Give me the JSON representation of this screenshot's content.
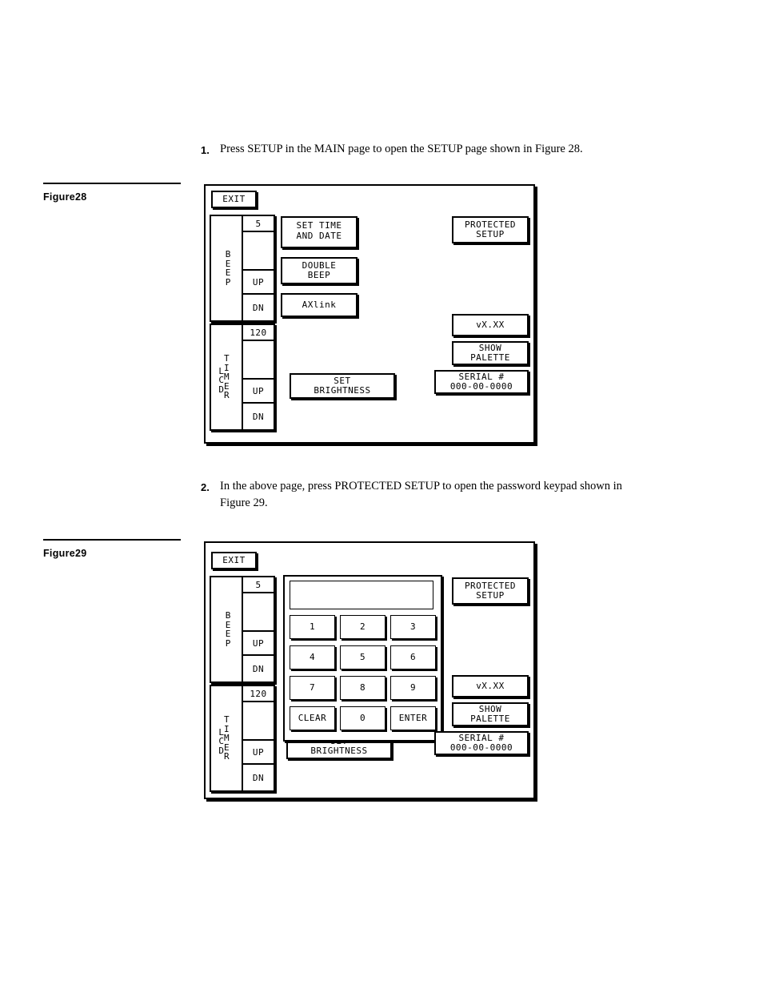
{
  "document": {
    "steps": [
      {
        "number": "1.",
        "text": "Press SETUP in the MAIN page to open the SETUP page shown in Figure 28."
      },
      {
        "number": "2.",
        "text": "In the above page, press PROTECTED SETUP to open the password keypad shown in Figure 29."
      }
    ],
    "figure_captions": [
      {
        "label": "Figure28"
      },
      {
        "label": "Figure29"
      }
    ]
  },
  "figure28": {
    "exit_button": "EXIT",
    "beep_group": {
      "label_primary": "BEEP",
      "value": "5",
      "up": "UP",
      "down": "DN"
    },
    "lcd_timer_group": {
      "label_primary": "LCD",
      "label_secondary": "TIMER",
      "value": "120",
      "up": "UP",
      "down": "DN"
    },
    "center_buttons": [
      {
        "name": "set-time-and-date",
        "line1": "SET TIME",
        "line2": "AND DATE"
      },
      {
        "name": "double-beep",
        "line1": "DOUBLE",
        "line2": "BEEP"
      },
      {
        "name": "axlink",
        "line1": "AXlink",
        "line2": ""
      },
      {
        "name": "set-brightness",
        "line1": "SET",
        "line2": "BRIGHTNESS"
      }
    ],
    "right_buttons": [
      {
        "name": "protected-setup",
        "line1": "PROTECTED",
        "line2": "SETUP"
      },
      {
        "name": "firmware-version",
        "line1": "vX.XX",
        "line2": ""
      },
      {
        "name": "show-palette",
        "line1": "SHOW",
        "line2": "PALETTE"
      },
      {
        "name": "serial-number",
        "line1": "SERIAL #",
        "line2": "000-00-0000"
      }
    ]
  },
  "figure29": {
    "exit_button": "EXIT",
    "beep_group": {
      "label_primary": "BEEP",
      "value": "5",
      "up": "UP",
      "down": "DN"
    },
    "lcd_timer_group": {
      "label_primary": "LCD",
      "label_secondary": "TIMER",
      "value": "120",
      "up": "UP",
      "down": "DN"
    },
    "keypad": {
      "display_value": "",
      "keys": [
        {
          "name": "key-1",
          "label": "1"
        },
        {
          "name": "key-2",
          "label": "2"
        },
        {
          "name": "key-3",
          "label": "3"
        },
        {
          "name": "key-4",
          "label": "4"
        },
        {
          "name": "key-5",
          "label": "5"
        },
        {
          "name": "key-6",
          "label": "6"
        },
        {
          "name": "key-7",
          "label": "7"
        },
        {
          "name": "key-8",
          "label": "8"
        },
        {
          "name": "key-9",
          "label": "9"
        },
        {
          "name": "key-clear",
          "label": "CLEAR"
        },
        {
          "name": "key-0",
          "label": "0"
        },
        {
          "name": "key-enter",
          "label": "ENTER"
        }
      ]
    },
    "set_brightness": {
      "line1": "SET",
      "line2": "BRIGHTNESS"
    },
    "right_buttons": [
      {
        "name": "protected-setup",
        "line1": "PROTECTED",
        "line2": "SETUP"
      },
      {
        "name": "firmware-version",
        "line1": "vX.XX",
        "line2": ""
      },
      {
        "name": "show-palette",
        "line1": "SHOW",
        "line2": "PALETTE"
      },
      {
        "name": "serial-number",
        "line1": "SERIAL #",
        "line2": "000-00-0000"
      }
    ]
  },
  "colors": {
    "ink": "#000000",
    "paper": "#ffffff"
  }
}
